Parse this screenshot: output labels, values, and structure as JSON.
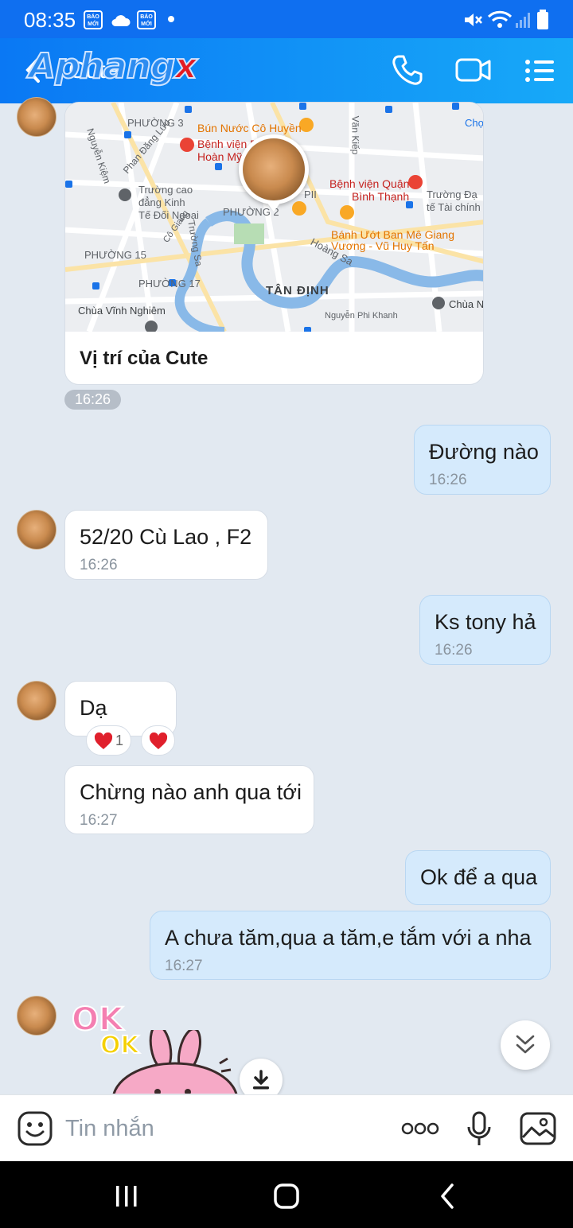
{
  "status_bar": {
    "time": "08:35",
    "app_badge": "BÁO MỚI"
  },
  "header": {
    "contact_name": "Cute",
    "watermark_main": "Aphang",
    "watermark_x": "x",
    "icons": [
      "back-icon",
      "phone-icon",
      "video-call-icon",
      "menu-icon"
    ]
  },
  "map_card": {
    "caption": "Vị trí của Cute",
    "labels": {
      "phuong3": "PHƯỜNG 3",
      "bun": "Bún Nước Cô Huyền",
      "benhvien": "Bệnh viện Đ",
      "hoanmy": "Hoàn Mỹ",
      "truongcao1": "Trường cao",
      "truongcao2": "đẳng Kinh",
      "truongcao3": "Tế Đối Ngoại",
      "bvbt1": "Bệnh viện Quận",
      "bvbt2": "Bình Thạnh",
      "truongdai1": "Trường Đạ",
      "truongdai2": "tế Tài chính",
      "cho": "Chợ",
      "phuong2": "PHƯỜNG 2",
      "pii": "PII",
      "banhuot1": "Bánh Ướt Ban Mê Giang",
      "banhuot2": "Vương - Vũ Huy Tấn",
      "phuong15": "PHƯỜNG 15",
      "phuong17": "PHƯỜNG 17",
      "tandinh": "TÂN ĐỊNH",
      "hoangsa": "Hoàng Sa",
      "chuavinh": "Chùa Vĩnh Nghiêm",
      "chuan": "Chùa N",
      "nguyenphikhanh": "Nguyễn Phi Khanh",
      "vankiep": "Văn Kiếp",
      "nguyenkiem": "Nguyễn Kiệm",
      "phandangluu": "Phan Đăng Lưu",
      "truongsa": "Trường Sa",
      "cogiang": "Cô Giang"
    }
  },
  "map_time": "16:26",
  "messages": [
    {
      "side": "me",
      "text": "Đường nào",
      "time": "16:26"
    },
    {
      "side": "them",
      "text": "52/20 Cù Lao , F2",
      "time": "16:26"
    },
    {
      "side": "me",
      "text": "Ks tony hả",
      "time": "16:26"
    },
    {
      "side": "them",
      "text": "Dạ",
      "reaction_count": "1"
    },
    {
      "side": "them",
      "text": "Chừng nào anh qua tới",
      "time": "16:27"
    },
    {
      "side": "me",
      "text": "Ok để a qua"
    },
    {
      "side": "me",
      "text": "A chưa tăm,qua a tăm,e tắm với a nha",
      "time": "16:27"
    }
  ],
  "sticker": {
    "text1": "OK",
    "text2": "OK"
  },
  "composer": {
    "placeholder": "Tin nhắn"
  },
  "colors": {
    "header": "#0a78f4",
    "my_bubble": "#d5eafc",
    "background": "#e2e9f1"
  }
}
